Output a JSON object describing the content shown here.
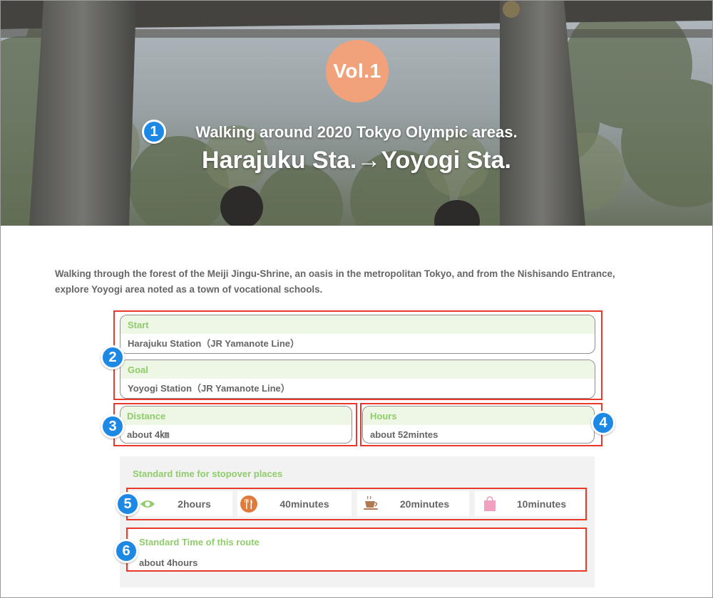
{
  "hero": {
    "vol_badge": "Vol.1",
    "subtitle": "Walking around 2020 Tokyo Olympic areas.",
    "title": "Harajuku Sta.→Yoyogi Sta."
  },
  "markers": [
    "1",
    "2",
    "3",
    "4",
    "5",
    "6"
  ],
  "intro": {
    "line1": "Walking through the forest of the Meiji Jingu-Shrine, an oasis in the metropolitan Tokyo, and from the Nishisando Entrance,",
    "line2": "explore Yoyogi area noted as a town of vocational schools."
  },
  "route": {
    "start_label": "Start",
    "start_value": "Harajuku Station（JR Yamanote Line）",
    "goal_label": "Goal",
    "goal_value": "Yoyogi Station（JR Yamanote Line）",
    "distance_label": "Distance",
    "distance_value": "about 4㎞",
    "hours_label": "Hours",
    "hours_value": "about 52mintes"
  },
  "stopover": {
    "title": "Standard time for stopover places",
    "items": [
      {
        "icon": "sightseeing-eye-icon",
        "label": "2hours"
      },
      {
        "icon": "restaurant-fork-knife-icon",
        "label": "40minutes"
      },
      {
        "icon": "cafe-cup-icon",
        "label": "20minutes"
      },
      {
        "icon": "shopping-bag-icon",
        "label": "10minutes"
      }
    ],
    "route_time_label": "Standard Time of this route",
    "route_time_value": "about 4hours"
  },
  "colors": {
    "badge": "#f2a27a",
    "marker": "#1e88e5",
    "highlight": "#e8392b",
    "label_green": "#8fcc6a",
    "head_bg": "#eef7e6",
    "text_gray": "#666666",
    "panel_bg": "#f2f2f2"
  }
}
